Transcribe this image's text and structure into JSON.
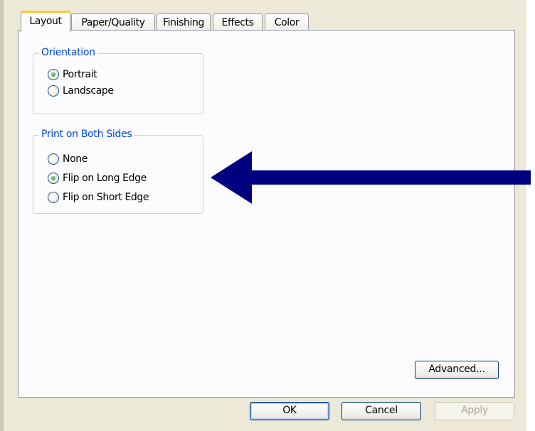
{
  "tabs": [
    {
      "label": "Layout",
      "active": true
    },
    {
      "label": "Paper/Quality",
      "active": false
    },
    {
      "label": "Finishing",
      "active": false
    },
    {
      "label": "Effects",
      "active": false
    },
    {
      "label": "Color",
      "active": false
    }
  ],
  "orientation": {
    "legend": "Orientation",
    "options": [
      {
        "label": "Portrait",
        "selected": true
      },
      {
        "label": "Landscape",
        "selected": false
      }
    ]
  },
  "duplex": {
    "legend": "Print on Both Sides",
    "options": [
      {
        "label": "None",
        "selected": false
      },
      {
        "label": "Flip on Long Edge",
        "selected": true
      },
      {
        "label": "Flip on Short Edge",
        "selected": false
      }
    ]
  },
  "buttons": {
    "advanced": "Advanced...",
    "ok": "OK",
    "cancel": "Cancel",
    "apply": "Apply"
  },
  "colors": {
    "arrow": "#000080",
    "legend_text": "#0046d5",
    "active_tab_accent": "#ffc83c"
  }
}
